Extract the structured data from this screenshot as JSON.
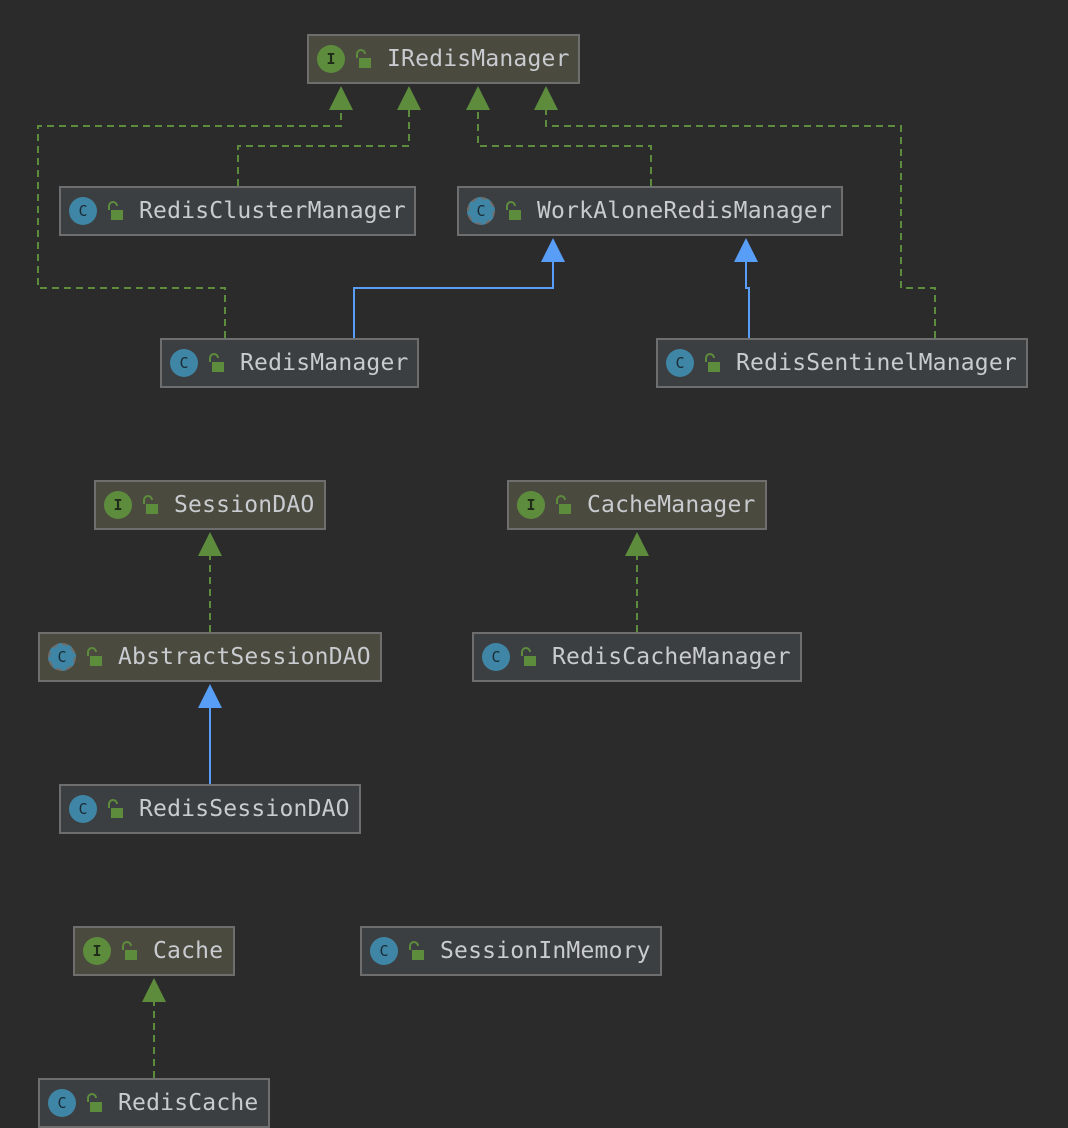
{
  "colors": {
    "background": "#2b2b2b",
    "implements_edge": "#5e8c3d",
    "extends_edge": "#589df6",
    "interface_badge": "#5e8c3d",
    "class_badge": "#3f86a6"
  },
  "nodes": {
    "iredismanager": {
      "label": "IRedisManager",
      "kind": "interface",
      "badge": "I"
    },
    "redisclustermanager": {
      "label": "RedisClusterManager",
      "kind": "class",
      "badge": "C"
    },
    "workaloneredismanager": {
      "label": "WorkAloneRedisManager",
      "kind": "abstract",
      "badge": "C"
    },
    "redismanager": {
      "label": "RedisManager",
      "kind": "class",
      "badge": "C"
    },
    "redissentinelmanager": {
      "label": "RedisSentinelManager",
      "kind": "class",
      "badge": "C"
    },
    "sessiondao": {
      "label": "SessionDAO",
      "kind": "interface",
      "badge": "I"
    },
    "cachemanager": {
      "label": "CacheManager",
      "kind": "interface",
      "badge": "I"
    },
    "abstractsessiondao": {
      "label": "AbstractSessionDAO",
      "kind": "abstract",
      "badge": "C"
    },
    "rediscachemanager": {
      "label": "RedisCacheManager",
      "kind": "class",
      "badge": "C"
    },
    "redissessiondao": {
      "label": "RedisSessionDAO",
      "kind": "class",
      "badge": "C"
    },
    "cache": {
      "label": "Cache",
      "kind": "interface",
      "badge": "I"
    },
    "sessioninmemory": {
      "label": "SessionInMemory",
      "kind": "class",
      "badge": "C"
    },
    "rediscache": {
      "label": "RedisCache",
      "kind": "class",
      "badge": "C"
    }
  },
  "relations": [
    {
      "from": "RedisClusterManager",
      "to": "IRedisManager",
      "type": "implements"
    },
    {
      "from": "WorkAloneRedisManager",
      "to": "IRedisManager",
      "type": "implements"
    },
    {
      "from": "RedisManager",
      "to": "IRedisManager",
      "type": "implements"
    },
    {
      "from": "RedisSentinelManager",
      "to": "IRedisManager",
      "type": "implements"
    },
    {
      "from": "RedisManager",
      "to": "WorkAloneRedisManager",
      "type": "extends"
    },
    {
      "from": "RedisSentinelManager",
      "to": "WorkAloneRedisManager",
      "type": "extends"
    },
    {
      "from": "AbstractSessionDAO",
      "to": "SessionDAO",
      "type": "implements"
    },
    {
      "from": "RedisSessionDAO",
      "to": "AbstractSessionDAO",
      "type": "extends"
    },
    {
      "from": "RedisCacheManager",
      "to": "CacheManager",
      "type": "implements"
    },
    {
      "from": "RedisCache",
      "to": "Cache",
      "type": "implements"
    }
  ]
}
